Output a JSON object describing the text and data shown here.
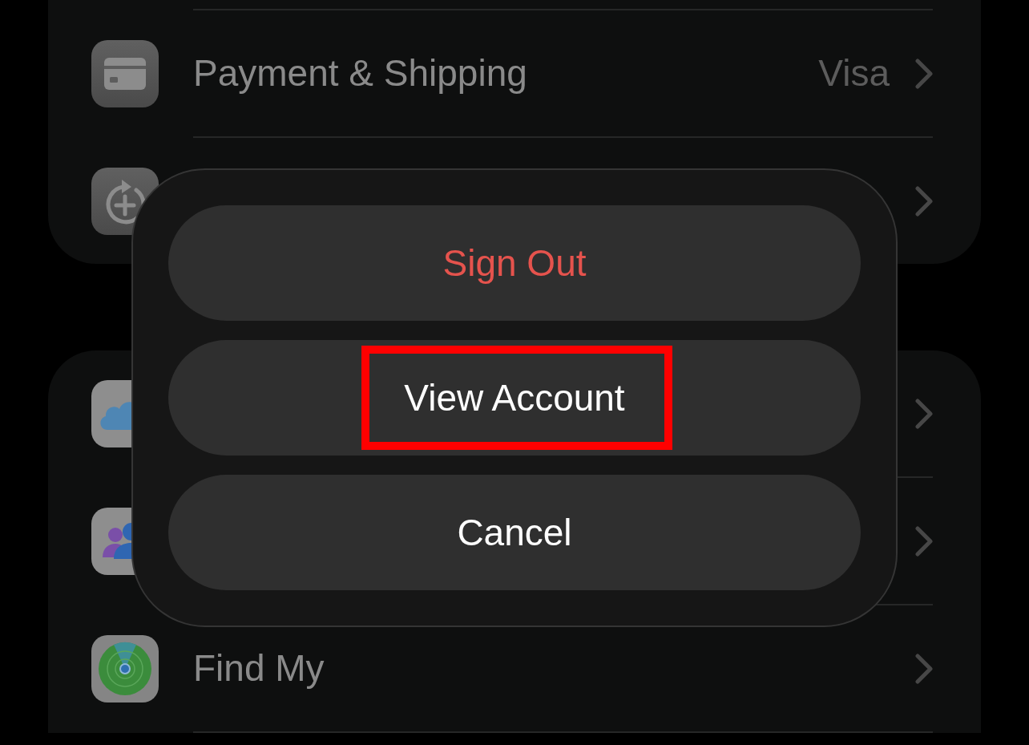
{
  "settings_groups": [
    {
      "rows": [
        {
          "kind": "card",
          "label": "Payment & Shipping",
          "value": "Visa"
        },
        {
          "kind": "restore"
        }
      ]
    },
    {
      "rows": [
        {
          "kind": "cloud"
        },
        {
          "kind": "family"
        },
        {
          "kind": "findmy",
          "label": "Find My"
        }
      ]
    }
  ],
  "action_sheet": {
    "actions": [
      {
        "kind": "destructive",
        "label": "Sign Out",
        "highlighted": false
      },
      {
        "kind": "default",
        "label": "View Account",
        "highlighted": true
      },
      {
        "kind": "default",
        "label": "Cancel",
        "highlighted": false
      }
    ]
  }
}
